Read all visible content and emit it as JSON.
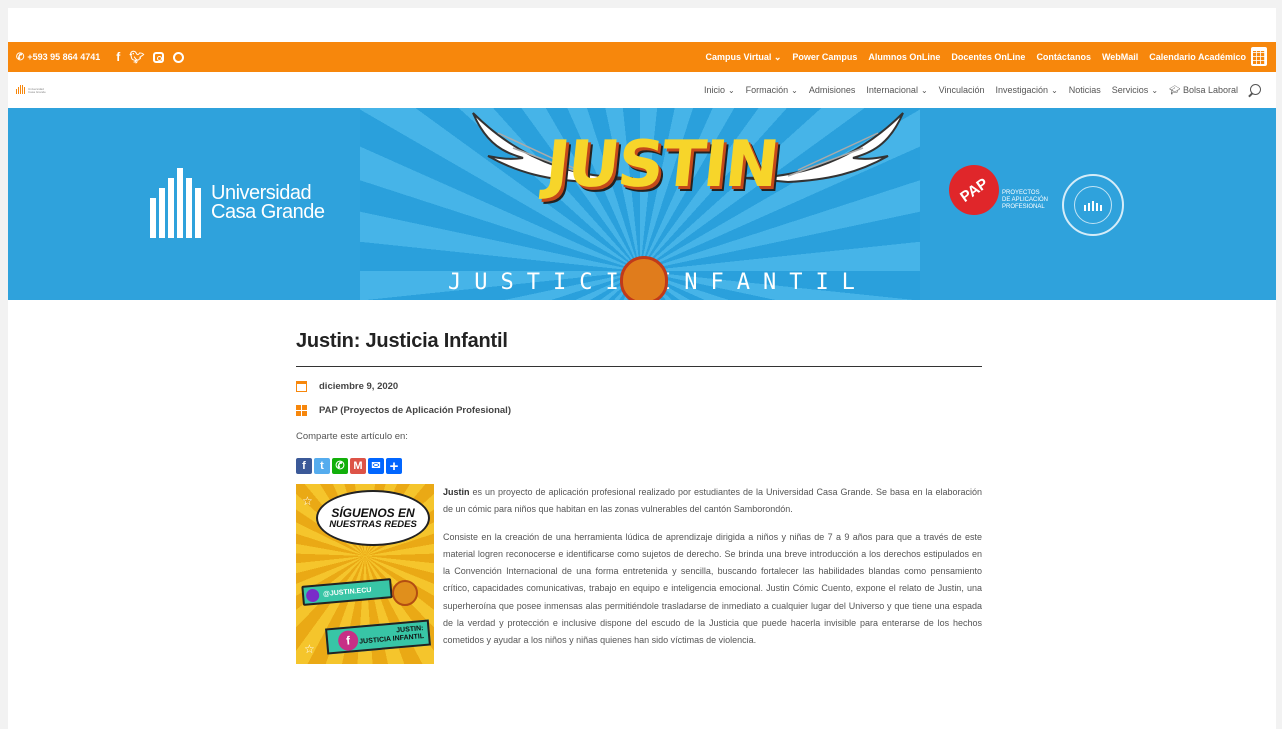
{
  "topbar": {
    "phone": "+593 95 864 4741",
    "social_icons": [
      "facebook-icon",
      "twitter-icon",
      "instagram-icon",
      "whatsapp-icon"
    ],
    "links": [
      {
        "label": "Campus Virtual",
        "dropdown": true
      },
      {
        "label": "Power Campus"
      },
      {
        "label": "Alumnos OnLine"
      },
      {
        "label": "Docentes OnLine"
      },
      {
        "label": "Contáctanos"
      },
      {
        "label": "WebMail"
      },
      {
        "label": "Calendario Académico"
      }
    ],
    "accent_color": "#f7870c"
  },
  "nav": {
    "items": [
      {
        "label": "Inicio",
        "dropdown": true
      },
      {
        "label": "Formación",
        "dropdown": true
      },
      {
        "label": "Admisiones"
      },
      {
        "label": "Internacional",
        "dropdown": true
      },
      {
        "label": "Vinculación"
      },
      {
        "label": "Investigación",
        "dropdown": true
      },
      {
        "label": "Noticias"
      },
      {
        "label": "Servicios",
        "dropdown": true
      },
      {
        "label": "Bolsa Laboral"
      }
    ],
    "chevron": "⌄"
  },
  "banner": {
    "university_line1": "Universidad",
    "university_line2": "Casa Grande",
    "title": "JUSTIN",
    "subtitle_left": "JUSTICIA",
    "subtitle_right": "INFANTIL",
    "pap_badge": "PAP",
    "pap_line1": "PROYECTOS",
    "pap_line2": "DE APLICACIÓN",
    "pap_line3": "PROFESIONAL",
    "background_color": "#2fa2dc"
  },
  "article": {
    "title": "Justin: Justicia Infantil",
    "date": "diciembre 9, 2020",
    "category": "PAP (Proyectos de Aplicación Profesional)",
    "share_label": "Comparte este artículo en:",
    "share_icons": [
      "facebook-share-icon",
      "twitter-share-icon",
      "whatsapp-share-icon",
      "gmail-share-icon",
      "email-share-icon",
      "more-share-icon"
    ],
    "poster": {
      "line1": "SÍGUENOS EN",
      "line2": "NUESTRAS REDES",
      "handle": "@JUSTIN.ECU",
      "page_line1": "JUSTIN:",
      "page_line2": "JUSTICIA INFANTIL"
    },
    "paragraph1_bold": "Justin",
    "paragraph1_rest": " es un proyecto de aplicación profesional realizado por estudiantes de la Universidad Casa Grande. Se basa en la elaboración de un cómic para niños que habitan en las zonas vulnerables del cantón Samborondón.",
    "paragraph2": "Consiste en la creación de una herramienta lúdica de aprendizaje dirigida a niños y niñas de 7 a 9 años para que a través de este material logren reconocerse e identificarse como sujetos de derecho. Se brinda una breve introducción a los derechos estipulados en la Convención Internacional de una forma entretenida y sencilla, buscando fortalecer las habilidades blandas como pensamiento crítico, capacidades comunicativas, trabajo en equipo e inteligencia emocional. Justin Cómic Cuento, expone el relato de Justin, una superheroína que posee inmensas alas permitiéndole trasladarse de inmediato a cualquier lugar del Universo y que tiene una espada de la verdad y protección e inclusive dispone del escudo de la Justicia que puede hacerla invisible para enterarse de los hechos cometidos y ayudar a los niños y niñas  quienes han sido víctimas de violencia."
  }
}
